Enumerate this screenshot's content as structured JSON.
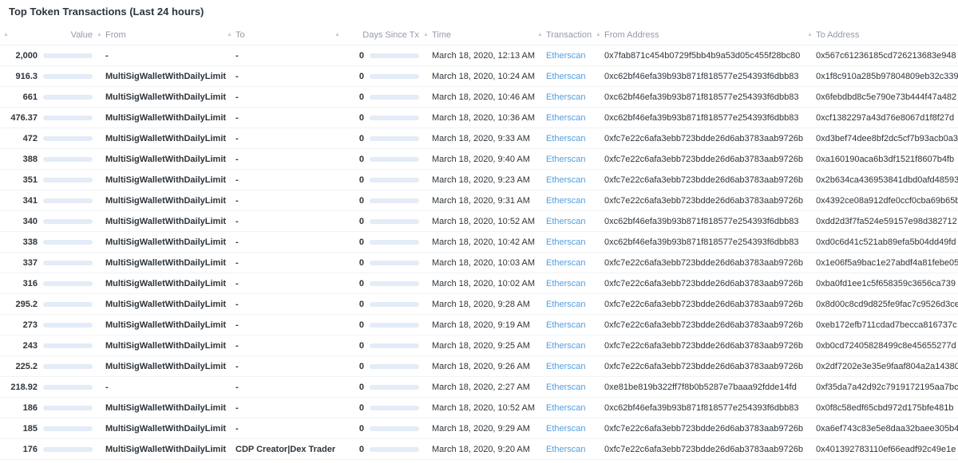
{
  "title": "Top Token Transactions (Last 24 hours)",
  "max_value": 2000,
  "columns": {
    "value": "Value",
    "from": "From",
    "to": "To",
    "days": "Days Since Tx",
    "time": "Time",
    "transaction": "Transaction",
    "from_address": "From Address",
    "to_address": "To Address"
  },
  "rows": [
    {
      "value": "2,000",
      "amount": 2000,
      "from": "-",
      "to": "-",
      "days": "0",
      "days_level": 0,
      "time": "March 18, 2020, 12:13 AM",
      "transaction": "Etherscan",
      "from_address": "0x7fab871c454b0729f5bb4b9a53d05c455f28bc80",
      "to_address": "0x567c61236185cd726213683e948"
    },
    {
      "value": "916.3",
      "amount": 916.3,
      "from": "MultiSigWalletWithDailyLimit",
      "to": "-",
      "days": "0",
      "days_level": 0,
      "time": "March 18, 2020, 10:24 AM",
      "transaction": "Etherscan",
      "from_address": "0xc62bf46efa39b93b871f818577e254393f6dbb83",
      "to_address": "0x1f8c910a285b97804809eb32c339"
    },
    {
      "value": "661",
      "amount": 661,
      "from": "MultiSigWalletWithDailyLimit",
      "to": "-",
      "days": "0",
      "days_level": 0,
      "time": "March 18, 2020, 10:46 AM",
      "transaction": "Etherscan",
      "from_address": "0xc62bf46efa39b93b871f818577e254393f6dbb83",
      "to_address": "0x6febdbd8c5e790e73b444f47a482"
    },
    {
      "value": "476.37",
      "amount": 476.37,
      "from": "MultiSigWalletWithDailyLimit",
      "to": "-",
      "days": "0",
      "days_level": 0,
      "time": "March 18, 2020, 10:36 AM",
      "transaction": "Etherscan",
      "from_address": "0xc62bf46efa39b93b871f818577e254393f6dbb83",
      "to_address": "0xcf1382297a43d76e8067d1f8f27d"
    },
    {
      "value": "472",
      "amount": 472,
      "from": "MultiSigWalletWithDailyLimit",
      "to": "-",
      "days": "0",
      "days_level": 0,
      "time": "March 18, 2020, 9:33 AM",
      "transaction": "Etherscan",
      "from_address": "0xfc7e22c6afa3ebb723bdde26d6ab3783aab9726b",
      "to_address": "0xd3bef74dee8bf2dc5cf7b93acb0a3"
    },
    {
      "value": "388",
      "amount": 388,
      "from": "MultiSigWalletWithDailyLimit",
      "to": "-",
      "days": "0",
      "days_level": 0,
      "time": "March 18, 2020, 9:40 AM",
      "transaction": "Etherscan",
      "from_address": "0xfc7e22c6afa3ebb723bdde26d6ab3783aab9726b",
      "to_address": "0xa160190aca6b3df1521f8607b4fb"
    },
    {
      "value": "351",
      "amount": 351,
      "from": "MultiSigWalletWithDailyLimit",
      "to": "-",
      "days": "0",
      "days_level": 0,
      "time": "March 18, 2020, 9:23 AM",
      "transaction": "Etherscan",
      "from_address": "0xfc7e22c6afa3ebb723bdde26d6ab3783aab9726b",
      "to_address": "0x2b634ca436953841dbd0afd48593"
    },
    {
      "value": "341",
      "amount": 341,
      "from": "MultiSigWalletWithDailyLimit",
      "to": "-",
      "days": "0",
      "days_level": 0,
      "time": "March 18, 2020, 9:31 AM",
      "transaction": "Etherscan",
      "from_address": "0xfc7e22c6afa3ebb723bdde26d6ab3783aab9726b",
      "to_address": "0x4392ce08a912dfe0ccf0cba69b65b"
    },
    {
      "value": "340",
      "amount": 340,
      "from": "MultiSigWalletWithDailyLimit",
      "to": "-",
      "days": "0",
      "days_level": 0,
      "time": "March 18, 2020, 10:52 AM",
      "transaction": "Etherscan",
      "from_address": "0xc62bf46efa39b93b871f818577e254393f6dbb83",
      "to_address": "0xdd2d3f7fa524e59157e98d382712"
    },
    {
      "value": "338",
      "amount": 338,
      "from": "MultiSigWalletWithDailyLimit",
      "to": "-",
      "days": "0",
      "days_level": 0,
      "time": "March 18, 2020, 10:42 AM",
      "transaction": "Etherscan",
      "from_address": "0xc62bf46efa39b93b871f818577e254393f6dbb83",
      "to_address": "0xd0c6d41c521ab89efa5b04dd49fd"
    },
    {
      "value": "337",
      "amount": 337,
      "from": "MultiSigWalletWithDailyLimit",
      "to": "-",
      "days": "0",
      "days_level": 0,
      "time": "March 18, 2020, 10:03 AM",
      "transaction": "Etherscan",
      "from_address": "0xfc7e22c6afa3ebb723bdde26d6ab3783aab9726b",
      "to_address": "0x1e06f5a9bac1e27abdf4a81febe05"
    },
    {
      "value": "316",
      "amount": 316,
      "from": "MultiSigWalletWithDailyLimit",
      "to": "-",
      "days": "0",
      "days_level": 0,
      "time": "March 18, 2020, 10:02 AM",
      "transaction": "Etherscan",
      "from_address": "0xfc7e22c6afa3ebb723bdde26d6ab3783aab9726b",
      "to_address": "0xba0fd1ee1c5f658359c3656ca739"
    },
    {
      "value": "295.2",
      "amount": 295.2,
      "from": "MultiSigWalletWithDailyLimit",
      "to": "-",
      "days": "0",
      "days_level": 0,
      "time": "March 18, 2020, 9:28 AM",
      "transaction": "Etherscan",
      "from_address": "0xfc7e22c6afa3ebb723bdde26d6ab3783aab9726b",
      "to_address": "0x8d00c8cd9d825fe9fac7c9526d3ce"
    },
    {
      "value": "273",
      "amount": 273,
      "from": "MultiSigWalletWithDailyLimit",
      "to": "-",
      "days": "0",
      "days_level": 0,
      "time": "March 18, 2020, 9:19 AM",
      "transaction": "Etherscan",
      "from_address": "0xfc7e22c6afa3ebb723bdde26d6ab3783aab9726b",
      "to_address": "0xeb172efb711cdad7becca816737c"
    },
    {
      "value": "243",
      "amount": 243,
      "from": "MultiSigWalletWithDailyLimit",
      "to": "-",
      "days": "0",
      "days_level": 0,
      "time": "March 18, 2020, 9:25 AM",
      "transaction": "Etherscan",
      "from_address": "0xfc7e22c6afa3ebb723bdde26d6ab3783aab9726b",
      "to_address": "0xb0cd72405828499c8e45655277d"
    },
    {
      "value": "225.2",
      "amount": 225.2,
      "from": "MultiSigWalletWithDailyLimit",
      "to": "-",
      "days": "0",
      "days_level": 0,
      "time": "March 18, 2020, 9:26 AM",
      "transaction": "Etherscan",
      "from_address": "0xfc7e22c6afa3ebb723bdde26d6ab3783aab9726b",
      "to_address": "0x2df7202e3e35e9faaf804a2a14380"
    },
    {
      "value": "218.92",
      "amount": 218.92,
      "from": "-",
      "to": "-",
      "days": "0",
      "days_level": 0,
      "time": "March 18, 2020, 2:27 AM",
      "transaction": "Etherscan",
      "from_address": "0xe81be819b322ff7f8b0b5287e7baaa92fdde14fd",
      "to_address": "0xf35da7a42d92c7919172195aa7bc"
    },
    {
      "value": "186",
      "amount": 186,
      "from": "MultiSigWalletWithDailyLimit",
      "to": "-",
      "days": "0",
      "days_level": 0,
      "time": "March 18, 2020, 10:52 AM",
      "transaction": "Etherscan",
      "from_address": "0xc62bf46efa39b93b871f818577e254393f6dbb83",
      "to_address": "0x0f8c58edf65cbd972d175bfe481b"
    },
    {
      "value": "185",
      "amount": 185,
      "from": "MultiSigWalletWithDailyLimit",
      "to": "-",
      "days": "0",
      "days_level": 0,
      "time": "March 18, 2020, 9:29 AM",
      "transaction": "Etherscan",
      "from_address": "0xfc7e22c6afa3ebb723bdde26d6ab3783aab9726b",
      "to_address": "0xa6ef743c83e5e8daa32baee305b4"
    },
    {
      "value": "176",
      "amount": 176,
      "from": "MultiSigWalletWithDailyLimit",
      "to": "CDP Creator|Dex Trader",
      "days": "0",
      "days_level": 0,
      "time": "March 18, 2020, 9:20 AM",
      "transaction": "Etherscan",
      "from_address": "0xfc7e22c6afa3ebb723bdde26d6ab3783aab9726b",
      "to_address": "0x401392783110ef66eadf92c49e1e"
    }
  ]
}
